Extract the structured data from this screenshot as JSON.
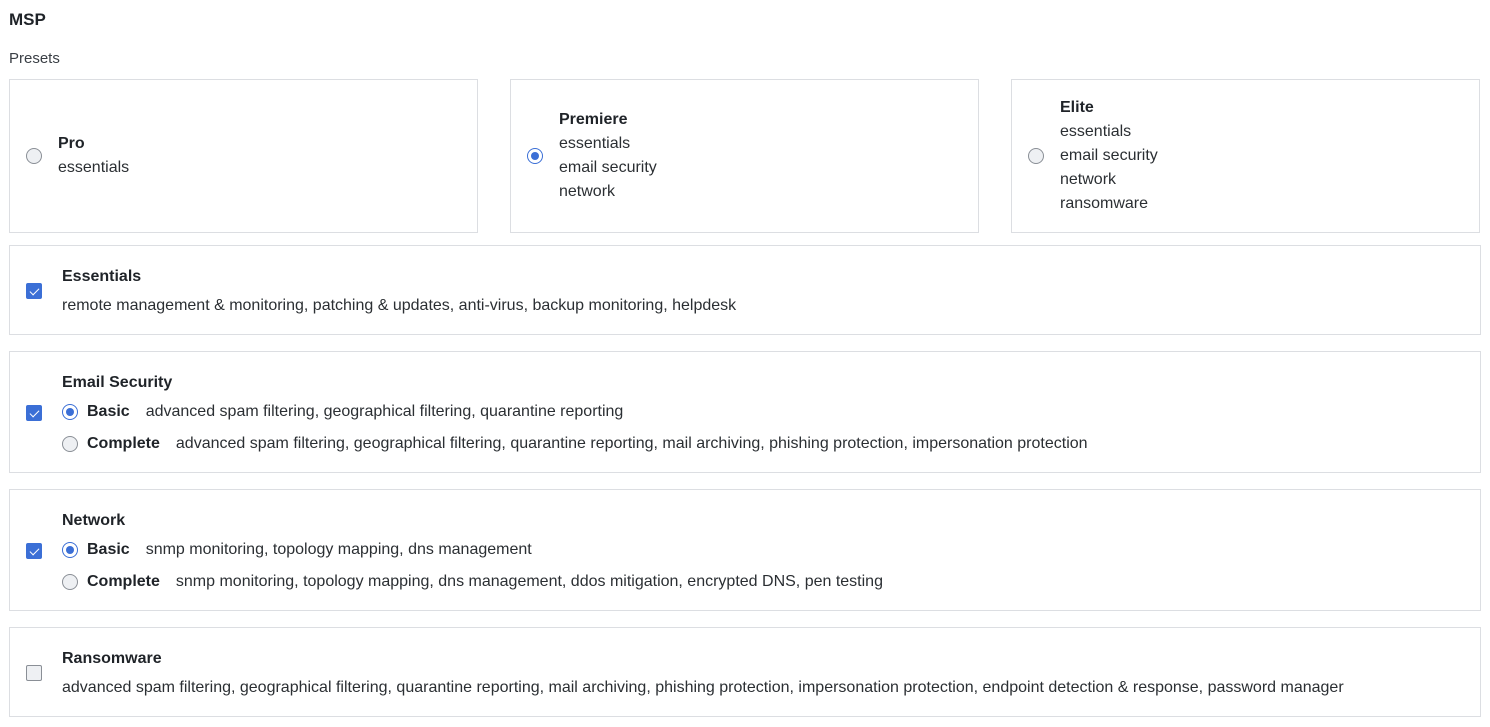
{
  "page": {
    "title": "MSP",
    "presets_label": "Presets"
  },
  "presets": [
    {
      "name": "Pro",
      "items": [
        "essentials"
      ],
      "selected": false
    },
    {
      "name": "Premiere",
      "items": [
        "essentials",
        "email security",
        "network"
      ],
      "selected": true
    },
    {
      "name": "Elite",
      "items": [
        "essentials",
        "email security",
        "network",
        "ransomware"
      ],
      "selected": false
    }
  ],
  "modules": {
    "essentials": {
      "title": "Essentials",
      "checked": true,
      "description": "remote management & monitoring, patching & updates, anti-virus, backup monitoring, helpdesk"
    },
    "email_security": {
      "title": "Email Security",
      "checked": true,
      "tiers": [
        {
          "name": "Basic",
          "selected": true,
          "description": "advanced spam filtering, geographical filtering, quarantine reporting"
        },
        {
          "name": "Complete",
          "selected": false,
          "description": "advanced spam filtering, geographical filtering, quarantine reporting, mail archiving, phishing protection, impersonation protection"
        }
      ]
    },
    "network": {
      "title": "Network",
      "checked": true,
      "tiers": [
        {
          "name": "Basic",
          "selected": true,
          "description": "snmp monitoring, topology mapping, dns management"
        },
        {
          "name": "Complete",
          "selected": false,
          "description": "snmp monitoring, topology mapping, dns management, ddos mitigation, encrypted DNS, pen testing"
        }
      ]
    },
    "ransomware": {
      "title": "Ransomware",
      "checked": false,
      "description": "advanced spam filtering, geographical filtering, quarantine reporting, mail archiving, phishing protection, impersonation protection, endpoint detection & response, password manager"
    }
  },
  "colors": {
    "accent": "#3b6fd6",
    "border": "#dcdee2",
    "text": "#1f2328"
  }
}
